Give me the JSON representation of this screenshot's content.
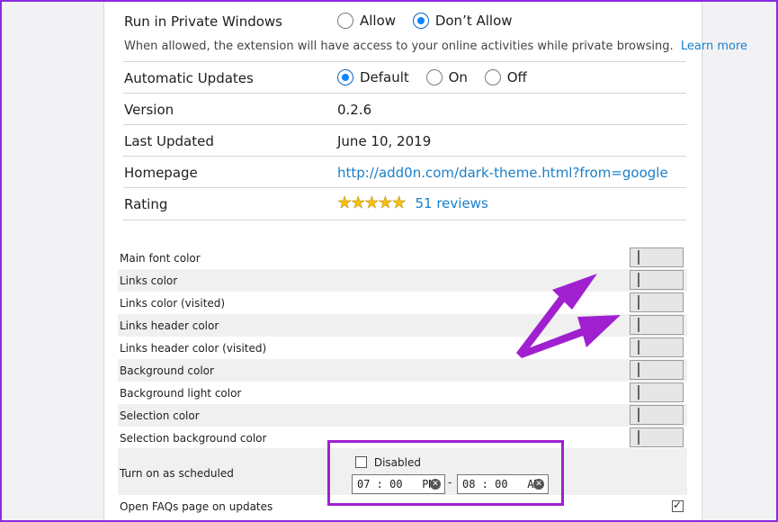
{
  "settings": {
    "private": {
      "label": "Run in Private Windows",
      "options": [
        "Allow",
        "Don’t Allow"
      ],
      "note": "When allowed, the extension will have access to your online activities while private browsing.",
      "learn_more": "Learn more"
    },
    "updates": {
      "label": "Automatic Updates",
      "options": [
        "Default",
        "On",
        "Off"
      ]
    },
    "version": {
      "label": "Version",
      "value": "0.2.6"
    },
    "last_updated": {
      "label": "Last Updated",
      "value": "June 10, 2019"
    },
    "homepage": {
      "label": "Homepage",
      "value": "http://add0n.com/dark-theme.html?from=google"
    },
    "rating": {
      "label": "Rating",
      "stars": 5,
      "reviews": "51 reviews"
    }
  },
  "colors": [
    {
      "label": "Main font color",
      "color": "#e8e8e8"
    },
    {
      "label": "Links color",
      "color": "#7b00ff"
    },
    {
      "label": "Links color (visited)",
      "color": "#ffff00"
    },
    {
      "label": "Links header color",
      "color": "#99b4d8"
    },
    {
      "label": "Links header color (visited)",
      "color": "#8a6a4e"
    },
    {
      "label": "Background color",
      "color": "#222222"
    },
    {
      "label": "Background light color",
      "color": "#4a4a4a"
    },
    {
      "label": "Selection color",
      "color": "#f2f2f2"
    },
    {
      "label": "Selection background color",
      "color": "#b4b4b4"
    }
  ],
  "schedule": {
    "label": "Turn on as scheduled",
    "disabled_label": "Disabled",
    "start_time": "07 : 00   PM",
    "separator": "-",
    "end_time": "08 : 00   AM"
  },
  "faq": {
    "label": "Open FAQs page on updates"
  },
  "accent": "#0a84ff",
  "annotation_color": "#a020d0"
}
